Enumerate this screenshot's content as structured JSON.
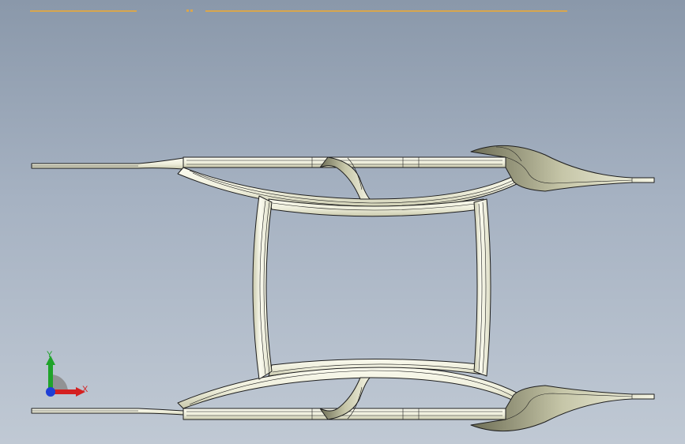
{
  "viewport": {
    "background_top": "#8a98aa",
    "background_bottom": "#c0c9d4",
    "accent": "#d8a64e"
  },
  "model": {
    "name_icon": "chassis-frame-model",
    "fill": "#f4f4e4",
    "shade": "#b8b89a",
    "edge": "#1e1e1e"
  },
  "triad": {
    "x_label": "X",
    "y_label": "Y",
    "x_color": "#d42020",
    "y_color": "#1fa32a",
    "z_color": "#1f3fd6"
  }
}
